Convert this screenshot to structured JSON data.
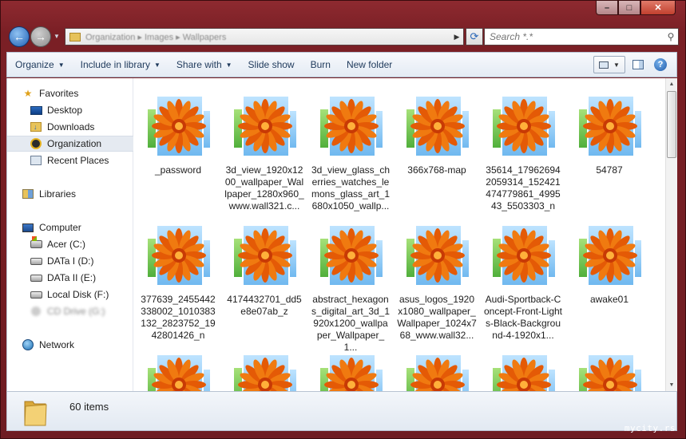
{
  "window": {
    "caption_buttons": [
      "–",
      "□",
      "✕"
    ]
  },
  "address": {
    "crumbs": "Organization ▸ Images ▸ Wallpapers",
    "search_placeholder": "Search *.*"
  },
  "toolbar": {
    "organize": "Organize",
    "include_in_library": "Include in library",
    "share_with": "Share with",
    "slide_show": "Slide show",
    "burn": "Burn",
    "new_folder": "New folder",
    "help": "?"
  },
  "nav": {
    "favorites": "Favorites",
    "desktop": "Desktop",
    "downloads": "Downloads",
    "organization": "Organization",
    "recent_places": "Recent Places",
    "libraries": "Libraries",
    "computer": "Computer",
    "acer": "Acer (C:)",
    "data1": "DATa I (D:)",
    "data2": "DATa II (E:)",
    "local_disk": "Local Disk (F:)",
    "blurred_drive": "CD Drive (G:)",
    "network": "Network"
  },
  "files": [
    {
      "name": "_password"
    },
    {
      "name": "3d_view_1920x1200_wallpaper_Wallpaper_1280x960_www.wall321.c..."
    },
    {
      "name": "3d_view_glass_cherries_watches_lemons_glass_art_1680x1050_wallp..."
    },
    {
      "name": "366x768-map"
    },
    {
      "name": "35614_179626942059314_152421474779861_499543_5503303_n"
    },
    {
      "name": "54787"
    },
    {
      "name": "377639_2455442338002_1010383132_2823752_1942801426_n"
    },
    {
      "name": "4174432701_dd5e8e07ab_z"
    },
    {
      "name": "abstract_hexagons_digital_art_3d_1920x1200_wallpaper_Wallpaper_1..."
    },
    {
      "name": "asus_logos_1920x1080_wallpaper_Wallpaper_1024x768_www.wall32..."
    },
    {
      "name": "Audi-Sportback-Concept-Front-Lights-Black-Background-4-1920x1..."
    },
    {
      "name": "awake01"
    },
    {
      "name": ""
    },
    {
      "name": ""
    },
    {
      "name": ""
    },
    {
      "name": ""
    },
    {
      "name": ""
    },
    {
      "name": ""
    }
  ],
  "details": {
    "item_count": "60 items"
  },
  "watermark": "mycity.rs"
}
